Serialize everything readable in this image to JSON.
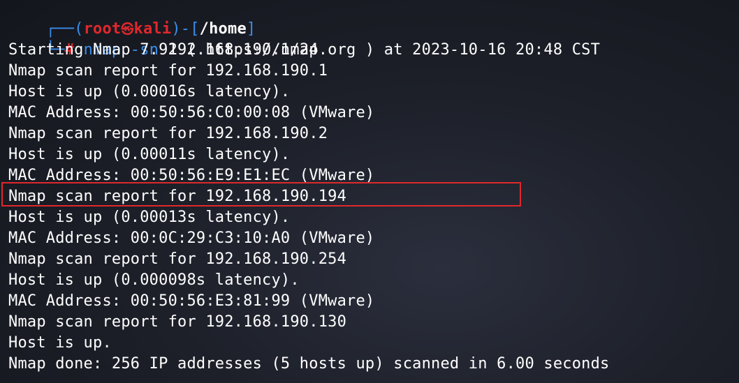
{
  "prompt": {
    "frame_top_left": "┌──(",
    "user": "root",
    "separator_icon": "㉿",
    "host": "kali",
    "frame_top_mid": ")-[",
    "cwd": "/home",
    "frame_top_right": "]",
    "frame_bottom": "└─",
    "hash": "#",
    "command": "nmap",
    "args": " -sn ",
    "target": "192.168.190.1/24"
  },
  "output": [
    "Starting Nmap 7.92 ( https://nmap.org ) at 2023-10-16 20:48 CST",
    "Nmap scan report for 192.168.190.1",
    "Host is up (0.00016s latency).",
    "MAC Address: 00:50:56:C0:00:08 (VMware)",
    "Nmap scan report for 192.168.190.2",
    "Host is up (0.00011s latency).",
    "MAC Address: 00:50:56:E9:E1:EC (VMware)",
    "Nmap scan report for 192.168.190.194",
    "Host is up (0.00013s latency).",
    "MAC Address: 00:0C:29:C3:10:A0 (VMware)",
    "Nmap scan report for 192.168.190.254",
    "Host is up (0.000098s latency).",
    "MAC Address: 00:50:56:E3:81:99 (VMware)",
    "Nmap scan report for 192.168.190.130",
    "Host is up.",
    "Nmap done: 256 IP addresses (5 hosts up) scanned in 6.00 seconds"
  ],
  "colors": {
    "background": "#1d2029",
    "text": "#ffffff",
    "prompt_frame": "#3b8eea",
    "prompt_user": "#e0282c",
    "highlight_box": "#e0282c"
  }
}
